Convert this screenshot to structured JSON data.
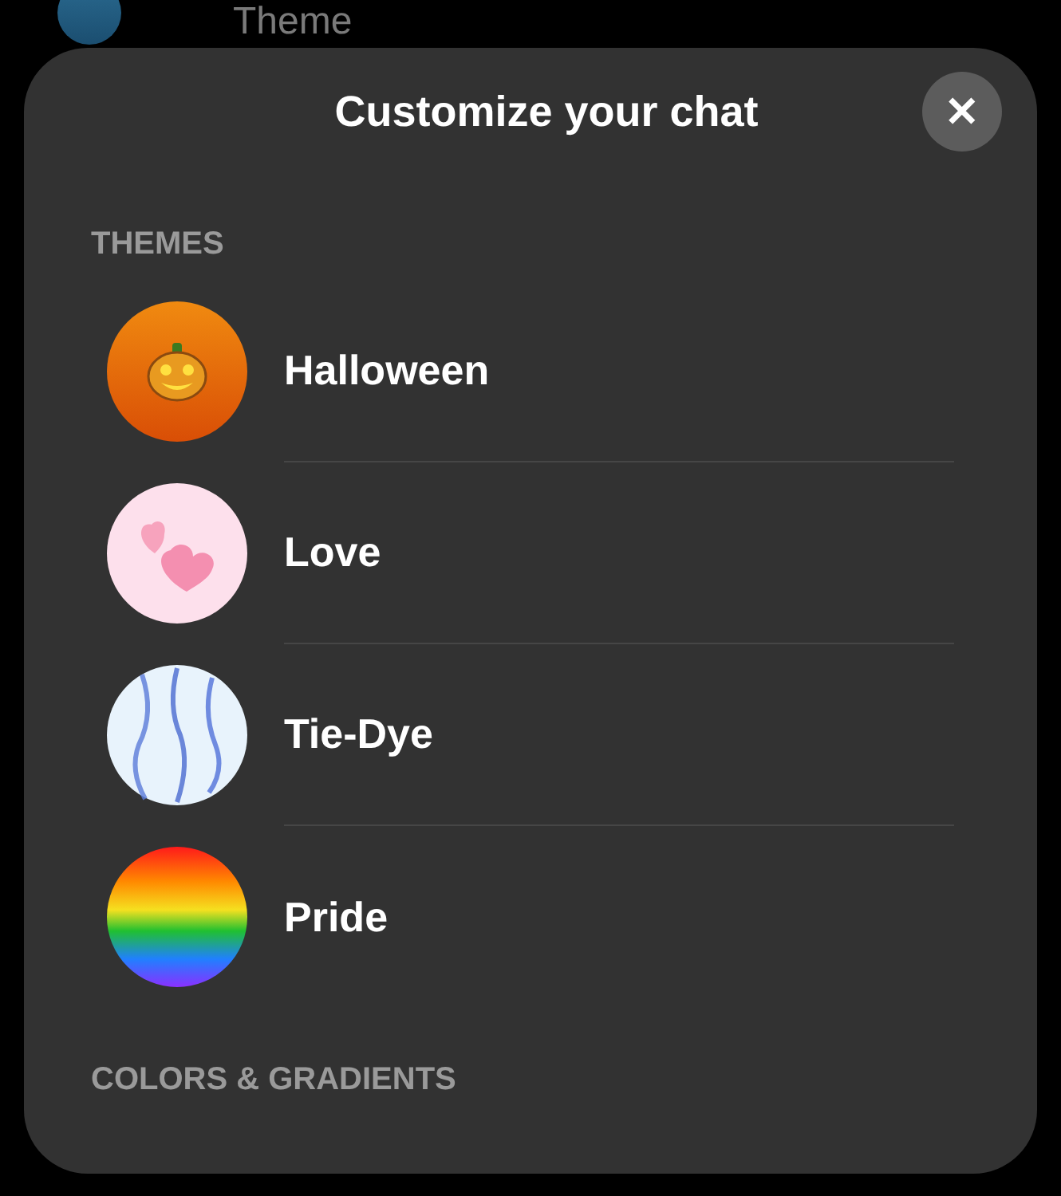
{
  "background_row": {
    "label": "Theme"
  },
  "sheet": {
    "title": "Customize your chat",
    "close": "✕"
  },
  "sections": [
    {
      "heading": "THEMES",
      "items": [
        {
          "label": "Halloween",
          "kind": "pumpkin"
        },
        {
          "label": "Love",
          "kind": "hearts"
        },
        {
          "label": "Tie-Dye",
          "kind": "tiedye"
        },
        {
          "label": "Pride",
          "kind": "rainbow"
        }
      ]
    },
    {
      "heading": "COLORS & GRADIENTS"
    }
  ]
}
